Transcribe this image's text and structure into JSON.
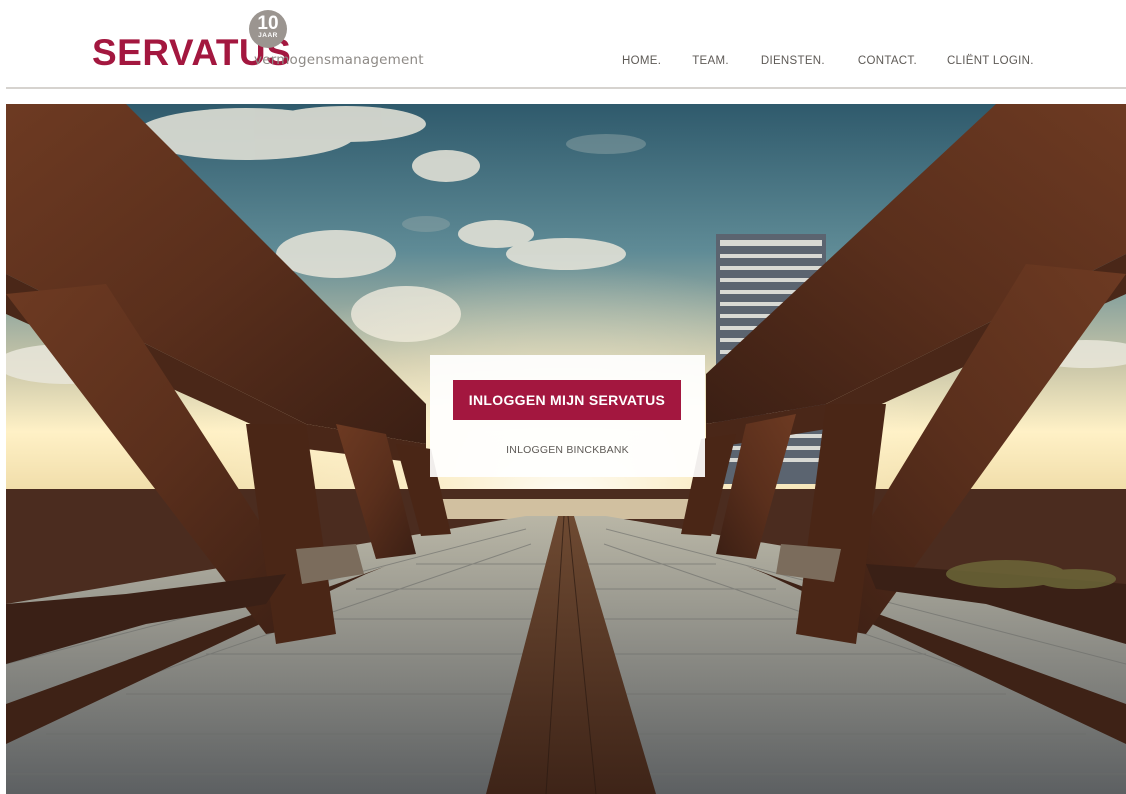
{
  "brand": {
    "name": "SERVATUS",
    "subtitle": "vermogensmanagement",
    "badge_number": "10",
    "badge_text": "JAAR",
    "color": "#a3173f"
  },
  "nav": {
    "home": "HOME.",
    "team": "TEAM.",
    "diensten": "DIENSTEN.",
    "contact": "CONTACT.",
    "client_login": "CLIËNT LOGIN."
  },
  "login": {
    "primary_label": "INLOGGEN MIJN SERVATUS",
    "secondary_label": "INLOGGEN BINCKBANK"
  },
  "colors": {
    "accent": "#a3173f",
    "nav_text": "#5e5a56",
    "divider": "#d6d3cf"
  }
}
